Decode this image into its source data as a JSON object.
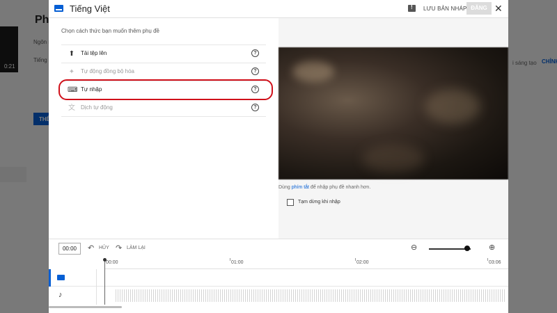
{
  "background": {
    "title": "Phụ",
    "thumb_time": "0:21",
    "label1": "Ngôn n",
    "label2": "Tiếng V",
    "right_text1": "i sáng tạo",
    "right_text2": "CHỈNH",
    "button_label": "THÊ"
  },
  "dialog": {
    "title": "Tiếng Việt",
    "save_draft_label": "LƯU BẢN NHÁP",
    "publish_label": "ĐĂNG",
    "close_symbol": "✕",
    "prompt": "Chọn cách thức bạn muốn thêm phụ đề",
    "options": [
      {
        "label": "Tải tệp lên",
        "icon": "upload-icon",
        "enabled": true
      },
      {
        "label": "Tự động đồng bộ hóa",
        "icon": "auto-sync-icon",
        "enabled": false
      },
      {
        "label": "Tự nhập",
        "icon": "keyboard-icon",
        "enabled": true
      },
      {
        "label": "Dịch tự động",
        "icon": "translate-icon",
        "enabled": false
      }
    ],
    "help_symbol": "?",
    "hint_prefix": "Dùng ",
    "hint_link": "phím tắt",
    "hint_suffix": " để nhập phụ đề nhanh hơn.",
    "pause_label": "Tạm dừng khi nhập"
  },
  "toolbar": {
    "time": "00:00",
    "undo_label": "HỦY",
    "redo_label": "LÀM LẠI"
  },
  "timeline": {
    "ticks": [
      "00:00",
      "01:00",
      "02:00",
      "03:06"
    ]
  },
  "colors": {
    "accent": "#065fd4",
    "highlight": "#d0101a"
  }
}
